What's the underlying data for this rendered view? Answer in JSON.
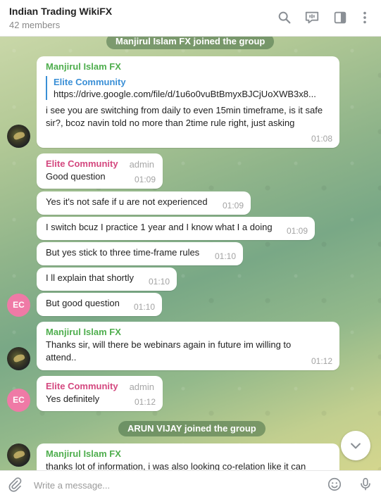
{
  "header": {
    "title": "Indian Trading WikiFX",
    "subtitle": "42 members"
  },
  "services": {
    "joined_1": "Manjirul Islam FX joined the group",
    "joined_2": "ARUN VIJAY joined the group"
  },
  "messages": [
    {
      "sender": "Manjirul Islam FX",
      "reply_name": "Elite Community",
      "reply_text": "https://drive.google.com/file/d/1u6o0vuBtBmyxBJCjUoXWB3x8...",
      "text": "i see you are switching from daily to even 15min timeframe, is it safe sir?, bcoz navin told no more than 2time rule right, just asking",
      "time": "01:08"
    },
    {
      "sender": "Elite Community",
      "role": "admin",
      "text": "Good question",
      "time": "01:09"
    },
    {
      "text": "Yes it's  not safe if u are not experienced",
      "time": "01:09"
    },
    {
      "text": "I switch bcuz I practice 1 year and I know what I a doing",
      "time": "01:09"
    },
    {
      "text": "But yes stick to three time-frame rules",
      "time": "01:10"
    },
    {
      "text": "I ll explain that shortly",
      "time": "01:10"
    },
    {
      "text": "But good question",
      "time": "01:10"
    },
    {
      "sender": "Manjirul Islam FX",
      "text": "Thanks sir, will there be webinars again in future im willing to attend..",
      "time": "01:12"
    },
    {
      "sender": "Elite Community",
      "role": "admin",
      "text": "Yes definitely",
      "time": "01:12"
    },
    {
      "sender": "Manjirul Islam FX",
      "text": "thanks lot of information, i was also looking co-relation like it can"
    }
  ],
  "avatars": {
    "ec_initials": "EC"
  },
  "composer": {
    "placeholder": "Write a message..."
  },
  "colors": {
    "sender_green": "#4fae4e",
    "sender_pink": "#d4487f",
    "reply_blue": "#3a8fd6",
    "avatar_pink": "#ef7aa6"
  },
  "icons": {
    "header": [
      "search-icon",
      "group-call-icon",
      "sidebar-toggle-icon",
      "more-options-icon"
    ],
    "composer": [
      "attach-icon",
      "emoji-icon",
      "microphone-icon"
    ],
    "scroll": "chevron-down-icon"
  }
}
